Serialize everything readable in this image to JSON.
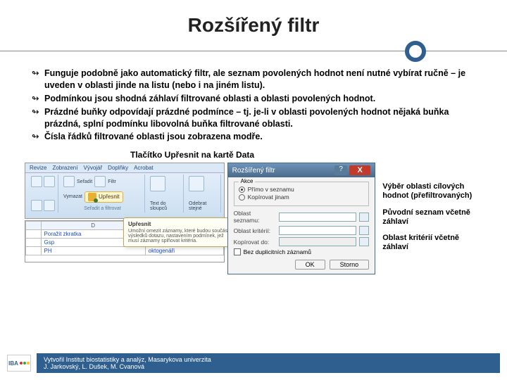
{
  "title": "Rozšířený filtr",
  "bullets": [
    "Funguje podobně jako automatický filtr, ale seznam povolených hodnot není nutné vybírat ručně – je uveden v oblasti jinde na listu (nebo i na jiném listu).",
    "Podmínkou jsou shodná záhlaví filtrované oblasti a oblasti povolených hodnot.",
    "Prázdné buňky odpovídají prázdné podmínce – tj. je-li v oblasti povolených hodnot nějaká buňka prázdná, splní podmínku libovolná buňka filtrované oblasti.",
    "Čísla řádků filtrované oblasti jsou zobrazena modře."
  ],
  "caption": "Tlačítko Upřesnit na kartě Data",
  "ribbon": {
    "tabs": [
      "Revize",
      "Zobrazení",
      "Vývojář",
      "Doplňky",
      "Acrobat"
    ],
    "upresnit": "Upřesnit",
    "group_sort": "Seřadit a filtrovat",
    "g2a": "Vymazat",
    "g2b": "Seřadit",
    "g2c": "Filtr",
    "g3": "Text do sloupců",
    "g4": "Odebrat stejné",
    "sheet_header": "D",
    "rows": [
      "Poražit zkratka",
      "Gsp",
      "PH"
    ],
    "rows2": [
      "",
      "",
      "oktogenáři"
    ]
  },
  "tooltip": {
    "hd": "Upřesnit",
    "body": "Umožní omezit záznamy, které budou součástí výsledků dotazu, nastavením podmínek, jež musí záznamy splňovat kritéria."
  },
  "dialog": {
    "title": "Rozšířený filtr",
    "group": "Akce",
    "r1": "Přímo v seznamu",
    "r2": "Kopírovat jinam",
    "f1": "Oblast seznamu:",
    "f2": "Oblast kritérií:",
    "f3": "Kopírovat do:",
    "chk": "Bez duplicitních záznamů",
    "ok": "OK",
    "cancel": "Storno"
  },
  "annots": {
    "a1": "Výběr oblasti cílových hodnot (přefiltrovaných)",
    "a2": "Původní seznam včetně záhlaví",
    "a3": "Oblast kritérií včetně záhlaví"
  },
  "footer": {
    "l1": "Vytvořil Institut biostatistiky a analýz, Masarykova univerzita",
    "l2": "J. Jarkovský, L. Dušek, M. Cvanová",
    "logo": "IBA"
  }
}
